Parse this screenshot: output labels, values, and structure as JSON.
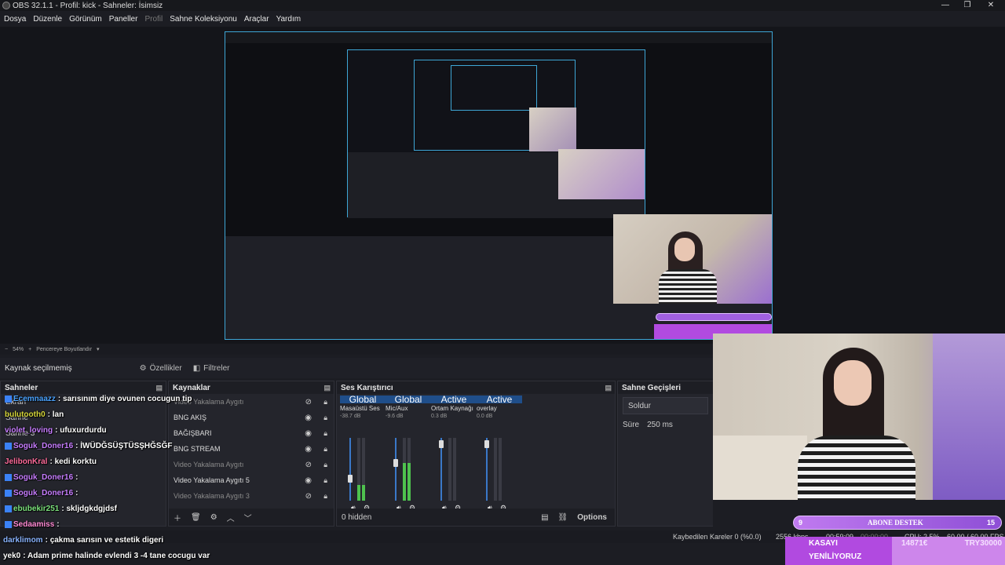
{
  "window": {
    "title": "OBS 32.1.1 - Profil: kick - Sahneler: İsimsiz",
    "minimize": "—",
    "maximize": "❐",
    "close": "✕"
  },
  "menu": [
    "Dosya",
    "Düzenle",
    "Görünüm",
    "Paneller",
    "Profil",
    "Sahne Koleksiyonu",
    "Araçlar",
    "Yardım"
  ],
  "zoombar": {
    "zoom": "54%",
    "minus": "−",
    "plus": "+",
    "fit": "Pencereye Boyutlandır"
  },
  "sourcebar": {
    "label": "Kaynak seçilmemiş",
    "properties": "Özellikler",
    "filters": "Filtreler"
  },
  "scenes": {
    "title": "Sahneler",
    "items": [
      "Ekran",
      "Sahne",
      "Sahne 3"
    ]
  },
  "sources": {
    "title": "Kaynaklar",
    "items": [
      {
        "name": "Video Yakalama Aygıtı",
        "visible": false
      },
      {
        "name": "BNG AKIŞ",
        "visible": true
      },
      {
        "name": "BAĞIŞBARI",
        "visible": true
      },
      {
        "name": "BNG STREAM",
        "visible": true
      },
      {
        "name": "Video Yakalama Aygıtı",
        "visible": false
      },
      {
        "name": "Video Yakalama Aygıtı 5",
        "visible": true
      },
      {
        "name": "Video Yakalama Aygıtı 3",
        "visible": false
      }
    ]
  },
  "mixer": {
    "title": "Ses Karıştırıcı",
    "headers": [
      "Global",
      "Global",
      "Active",
      "Active"
    ],
    "channels": [
      {
        "name": "Masaüstü Ses",
        "db": "-38.7 dB",
        "level": 0.25,
        "fader": 0.35
      },
      {
        "name": "Mic/Aux",
        "db": "-9.6 dB",
        "level": 0.6,
        "fader": 0.6
      },
      {
        "name": "Ortam Kaynağı",
        "db": "0.3 dB",
        "level": 0.0,
        "fader": 0.9
      },
      {
        "name": "overlay",
        "db": "0.0 dB",
        "level": 0.0,
        "fader": 0.9
      }
    ],
    "hidden": "0 hidden",
    "options": "Options"
  },
  "transitions": {
    "title": "Sahne Geçişleri",
    "selected": "Soldur",
    "duration_label": "Süre",
    "duration": "250 ms"
  },
  "status": {
    "dropped": "Kaybedilen Kareler 0 (%0.0)",
    "bitrate": "2556 kbps",
    "stream_time": "00:59:09",
    "rec_time": "00:00:00",
    "cpu": "CPU: 2.5%",
    "fps": "60.00 / 60.00 FPS"
  },
  "chat": [
    {
      "user": "Ecemnaazz",
      "msg": "sarısınım diye ovunen cocugun tip",
      "color": "#4aa3ff"
    },
    {
      "user": "bulutooth0",
      "msg": "lan",
      "color": "#d6d63a"
    },
    {
      "user": "violet_loving",
      "msg": "ufuxurdurdu",
      "color": "#c77dff"
    },
    {
      "user": "Soguk_Doner16",
      "msg": "İWÜDĞSÜŞTÜSŞHĞSĞF",
      "color": "#c77dff"
    },
    {
      "user": "JelibonKral",
      "msg": "kedi korktu",
      "color": "#ff6b9a"
    },
    {
      "user": "Soguk_Doner16",
      "msg": "",
      "color": "#c77dff"
    },
    {
      "user": "Soguk_Doner16",
      "msg": "",
      "color": "#c77dff"
    },
    {
      "user": "ebubekir251",
      "msg": "skljdgkdgjdsf",
      "color": "#7be07b"
    },
    {
      "user": "Sedaamiss",
      "msg": "",
      "color": "#ff8ad4"
    },
    {
      "user": "darklimom",
      "msg": "çakma sarısın ve estetik digeri",
      "color": "#8ab4ff"
    },
    {
      "user": "yek0",
      "msg": "Adam prime halinde evlendi 3 -4 tane cocugu var",
      "color": "#ffffff"
    }
  ],
  "alert": {
    "left": "9",
    "label": "ABONE DESTEK",
    "right": "15"
  },
  "donation": {
    "line1": "KASAYI",
    "line2": "YENİLİYORUZ",
    "amount": "14871€",
    "goal": "TRY30000"
  }
}
